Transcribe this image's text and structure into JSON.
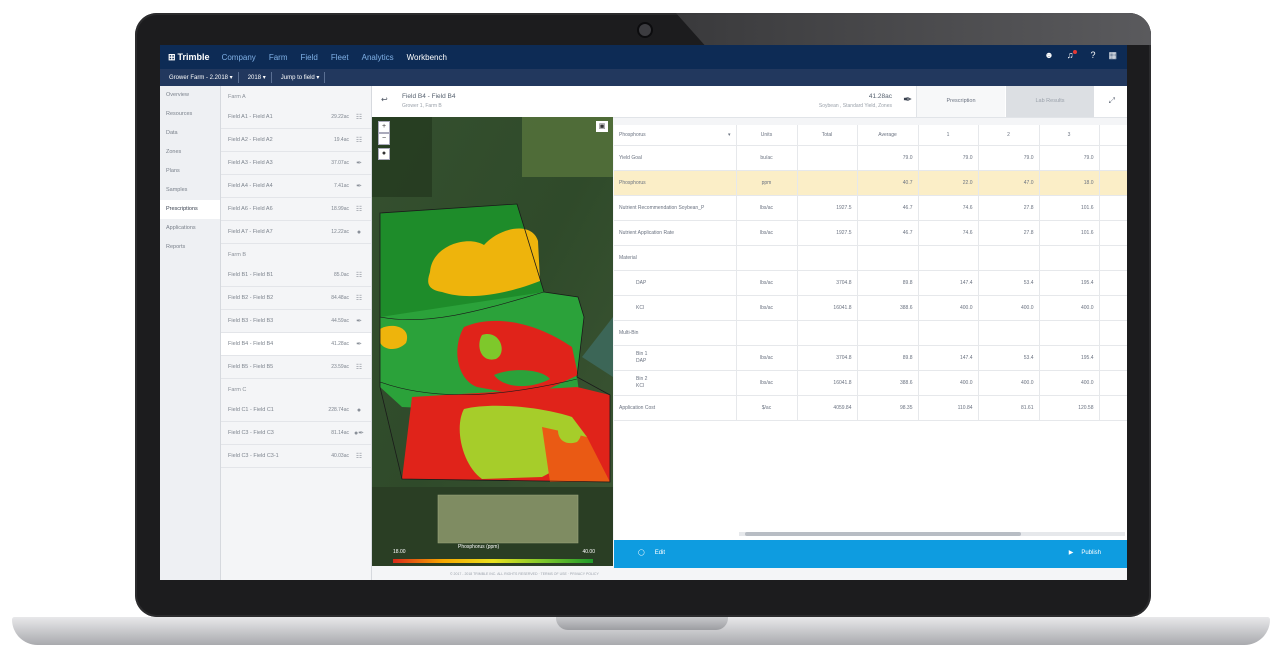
{
  "nav": {
    "logo": "Trimble",
    "links": [
      "Company",
      "Farm",
      "Field",
      "Fleet",
      "Analytics",
      "Workbench"
    ],
    "active": "Workbench"
  },
  "subnav": {
    "grower": "Grower Farm - 2.2018 ▾",
    "year": "2018 ▾",
    "jump": "Jump to field ▾"
  },
  "leftnav": [
    "Overview",
    "Resources",
    "Data",
    "Zones",
    "Plans",
    "Samples",
    "Prescriptions",
    "Applications",
    "Reports"
  ],
  "leftnav_active": "Prescriptions",
  "fieldlist": {
    "groups": [
      {
        "label": "Farm A",
        "fields": [
          {
            "name": "Field A1 - Field A1",
            "area": "29.22ac",
            "icon": "seed-icon"
          },
          {
            "name": "Field A2 - Field A2",
            "area": "19.4ac",
            "icon": "seed-icon"
          },
          {
            "name": "Field A3 - Field A3",
            "area": "37.07ac",
            "icon": "brush-icon"
          },
          {
            "name": "Field A4 - Field A4",
            "area": "7.41ac",
            "icon": "brush-icon"
          },
          {
            "name": "Field A6 - Field A6",
            "area": "18.99ac",
            "icon": "seed-icon"
          },
          {
            "name": "Field A7 - Field A7",
            "area": "12.22ac",
            "icon": "drop-icon"
          }
        ]
      },
      {
        "label": "Farm B",
        "fields": [
          {
            "name": "Field B1 - Field B1",
            "area": "85.0ac",
            "icon": "seed-icon"
          },
          {
            "name": "Field B2 - Field B2",
            "area": "84.48ac",
            "icon": "seed-icon"
          },
          {
            "name": "Field B3 - Field B3",
            "area": "44.59ac",
            "icon": "brush-icon"
          },
          {
            "name": "Field B4 - Field B4",
            "area": "41.28ac",
            "icon": "brush-icon"
          },
          {
            "name": "Field B5 - Field B5",
            "area": "23.59ac",
            "icon": "seed-icon"
          }
        ]
      },
      {
        "label": "Farm C",
        "fields": [
          {
            "name": "Field C1 - Field C1",
            "area": "228.74ac",
            "icon": "drop-icon"
          },
          {
            "name": "Field C3 - Field C3",
            "area": "81.14ac",
            "icon": "drop-brush-icon"
          },
          {
            "name": "Field C3 - Field C3-1",
            "area": "40.03ac",
            "icon": "seed-icon"
          }
        ]
      }
    ],
    "active_field": "Field B4 - Field B4"
  },
  "header": {
    "title": "Field B4 - Field B4",
    "subtitle": "Grower 1, Farm B",
    "area": "41.28ac",
    "description": "Soybean , Standard Yield, Zones",
    "tab_prescription": "Prescription",
    "tab_lab": "Lab Results"
  },
  "map": {
    "legend_title": "Phosphorus (ppm)",
    "legend_min": "18.00",
    "legend_max": "40.00",
    "zoom_in": "+",
    "zoom_out": "−"
  },
  "table": {
    "selector": "Phosphorus",
    "columns": [
      "Units",
      "Total",
      "Average",
      "1",
      "2",
      "3"
    ],
    "rows": [
      {
        "label": "Yield Goal",
        "units": "bu/ac",
        "total": "",
        "average": "79.0",
        "z1": "79.0",
        "z2": "79.0",
        "z3": "79.0"
      },
      {
        "label": "Phosphorus",
        "units": "ppm",
        "total": "",
        "average": "40.7",
        "z1": "22.0",
        "z2": "47.0",
        "z3": "18.0",
        "highlight": true
      },
      {
        "label": "Nutrient Recommendation Soybean_P",
        "units": "lbs/ac",
        "total": "1927.5",
        "average": "46.7",
        "z1": "74.6",
        "z2": "27.8",
        "z3": "101.6"
      },
      {
        "label": "Nutrient Application Rate",
        "units": "lbs/ac",
        "total": "1927.5",
        "average": "46.7",
        "z1": "74.6",
        "z2": "27.8",
        "z3": "101.6"
      },
      {
        "label": "Material",
        "units": "",
        "total": "",
        "average": "",
        "z1": "",
        "z2": "",
        "z3": ""
      },
      {
        "label": "DAP",
        "units": "lbs/ac",
        "total": "3704.8",
        "average": "89.8",
        "z1": "147.4",
        "z2": "53.4",
        "z3": "195.4",
        "indent": true
      },
      {
        "label": "KCl",
        "units": "lbs/ac",
        "total": "16041.8",
        "average": "388.6",
        "z1": "400.0",
        "z2": "400.0",
        "z3": "400.0",
        "indent": true
      },
      {
        "label": "Multi-Bin",
        "units": "",
        "total": "",
        "average": "",
        "z1": "",
        "z2": "",
        "z3": ""
      },
      {
        "label": "Bin 1\nDAP",
        "units": "lbs/ac",
        "total": "3704.8",
        "average": "89.8",
        "z1": "147.4",
        "z2": "53.4",
        "z3": "195.4",
        "indent": true
      },
      {
        "label": "Bin 2\nKCl",
        "units": "lbs/ac",
        "total": "16041.8",
        "average": "388.6",
        "z1": "400.0",
        "z2": "400.0",
        "z3": "400.0",
        "indent": true
      },
      {
        "label": "Application Cost",
        "units": "$/ac",
        "total": "4059.84",
        "average": "98.35",
        "z1": "110.84",
        "z2": "81.61",
        "z3": "120.58"
      }
    ]
  },
  "actions": {
    "edit": "Edit",
    "publish": "Publish"
  },
  "footer": "© 2017 - 2018 TRIMBLE INC. ALL RIGHTS RESERVED · TERMS OF USE · PRIVACY POLICY",
  "colors": {
    "nav_bg": "#0d2b55",
    "accent": "#0e9ce0",
    "highlight_row": "#fbeec7"
  }
}
